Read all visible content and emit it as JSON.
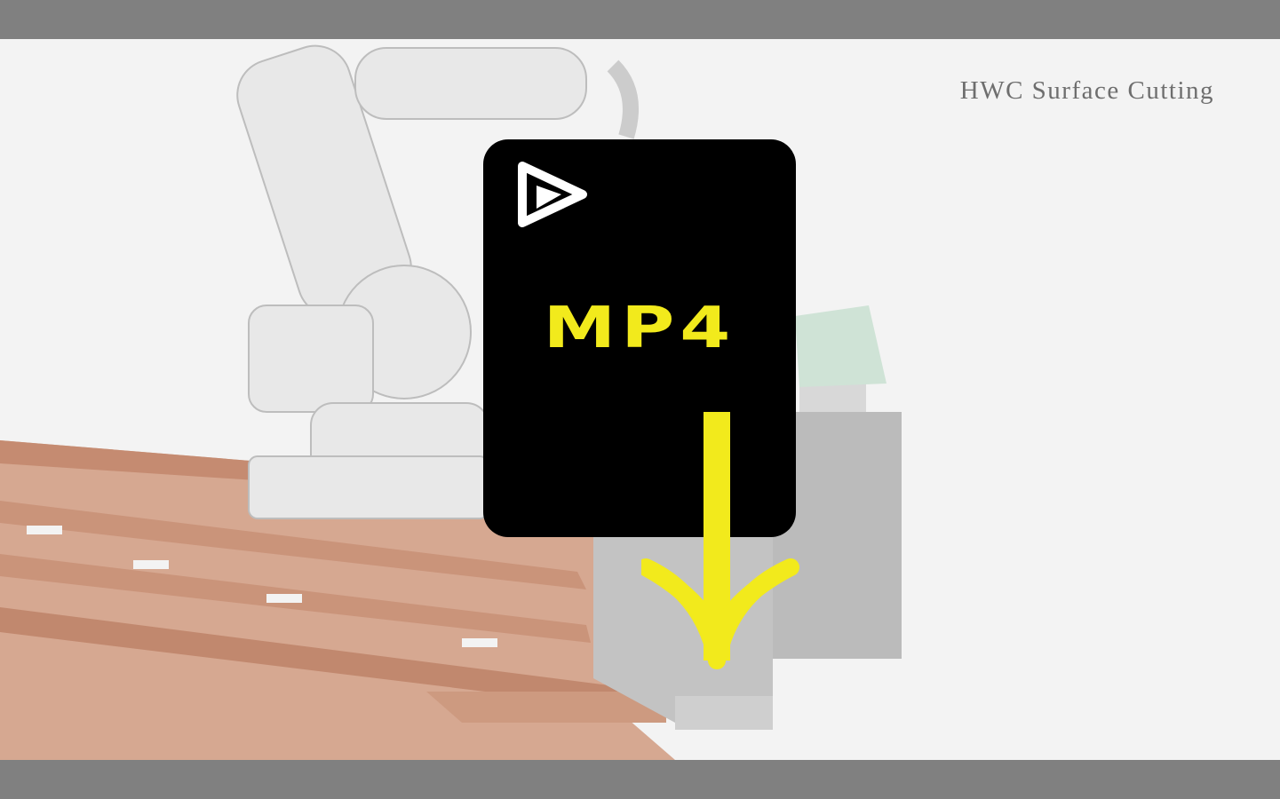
{
  "viewer": {
    "title": "HWC Surface Cutting",
    "file_type_label": "MP4"
  },
  "icons": {
    "play": "play-triangle-icon",
    "download": "download-arrow-icon"
  },
  "colors": {
    "frame_bar": "#808080",
    "background": "#f3f3f3",
    "badge_background": "#000000",
    "accent_yellow": "#f2ea1c",
    "rail_copper": "#c98a6c",
    "block_gray": "#bdbdbd",
    "sheet_green": "#cfe3d6"
  }
}
